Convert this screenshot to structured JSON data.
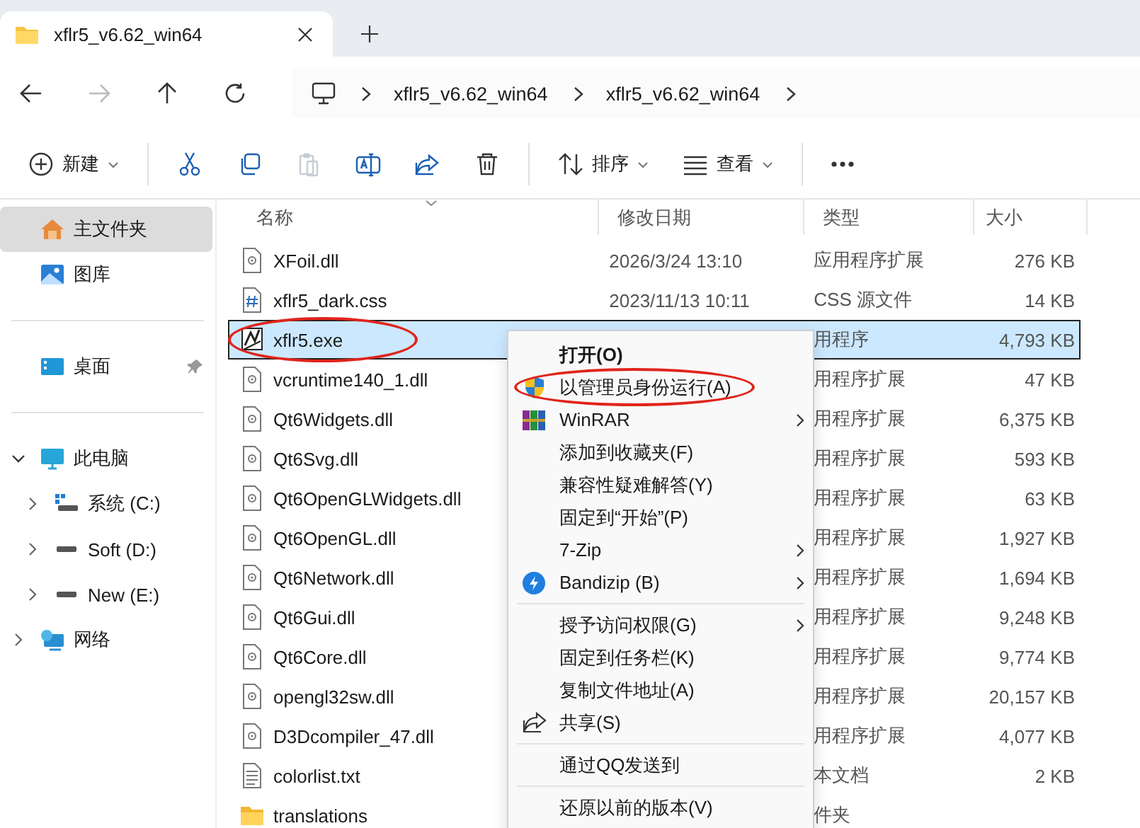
{
  "window": {
    "tab": {
      "title": "xflr5_v6.62_win64",
      "selected": true
    }
  },
  "address_bar": {
    "crumbs": [
      "xflr5_v6.62_win64",
      "xflr5_v6.62_win64"
    ]
  },
  "nav": [
    {
      "kind": "back",
      "disabled": false
    },
    {
      "kind": "forward",
      "disabled": true
    },
    {
      "kind": "up",
      "disabled": false
    },
    {
      "kind": "refresh",
      "disabled": false
    }
  ],
  "toolbar": [
    {
      "kind": "new",
      "label": "新建",
      "dropdown": true,
      "disabled": false
    },
    {
      "kind": "sep"
    },
    {
      "kind": "cut",
      "disabled": false
    },
    {
      "kind": "copy",
      "disabled": false
    },
    {
      "kind": "paste",
      "disabled": true
    },
    {
      "kind": "rename",
      "disabled": false
    },
    {
      "kind": "share",
      "disabled": false
    },
    {
      "kind": "delete",
      "disabled": false
    },
    {
      "kind": "sep"
    },
    {
      "kind": "sort",
      "label": "排序",
      "dropdown": true,
      "disabled": false
    },
    {
      "kind": "view",
      "label": "查看",
      "dropdown": true,
      "disabled": false
    },
    {
      "kind": "sep"
    },
    {
      "kind": "more",
      "disabled": false
    }
  ],
  "sidebar": {
    "sections": [
      [
        {
          "kind": "home",
          "label": "主文件夹",
          "selected": true,
          "pinned": false
        },
        {
          "kind": "gallery",
          "label": "图库",
          "selected": false,
          "pinned": false
        }
      ],
      [
        {
          "kind": "desktop",
          "label": "桌面",
          "selected": false,
          "pinned": true
        }
      ],
      [
        {
          "kind": "pc",
          "label": "此电脑",
          "selected": false,
          "pinned": false,
          "expanded": true,
          "children": [
            {
              "kind": "sysdrive",
              "label": "系统 (C:)",
              "selected": false,
              "pinned": false,
              "expanded": false
            },
            {
              "kind": "drive",
              "label": "Soft (D:)",
              "selected": false,
              "pinned": false,
              "expanded": false
            },
            {
              "kind": "drive",
              "label": "New (E:)",
              "selected": false,
              "pinned": false,
              "expanded": false
            }
          ]
        },
        {
          "kind": "network",
          "label": "网络",
          "selected": false,
          "pinned": false,
          "expanded": false
        }
      ]
    ]
  },
  "table": {
    "columns": [
      "名称",
      "修改日期",
      "类型",
      "大小"
    ],
    "rows": [
      {
        "kind": "dll",
        "name": "XFoil.dll",
        "date": "2026/3/24 13:10",
        "type": "应用程序扩展",
        "size": "276 KB",
        "selected": false,
        "circled": false
      },
      {
        "kind": "css",
        "name": "xflr5_dark.css",
        "date": "2023/11/13 10:11",
        "type": "CSS 源文件",
        "size": "14 KB",
        "selected": false,
        "circled": false
      },
      {
        "kind": "exe",
        "name": "xflr5.exe",
        "type": "用程序",
        "size": "4,793 KB",
        "selected": true,
        "circled": true
      },
      {
        "kind": "dll",
        "name": "vcruntime140_1.dll",
        "type": "用程序扩展",
        "size": "47 KB",
        "selected": false,
        "circled": false
      },
      {
        "kind": "dll",
        "name": "Qt6Widgets.dll",
        "type": "用程序扩展",
        "size": "6,375 KB",
        "selected": false,
        "circled": false
      },
      {
        "kind": "dll",
        "name": "Qt6Svg.dll",
        "type": "用程序扩展",
        "size": "593 KB",
        "selected": false,
        "circled": false
      },
      {
        "kind": "dll",
        "name": "Qt6OpenGLWidgets.dll",
        "type": "用程序扩展",
        "size": "63 KB",
        "selected": false,
        "circled": false
      },
      {
        "kind": "dll",
        "name": "Qt6OpenGL.dll",
        "type": "用程序扩展",
        "size": "1,927 KB",
        "selected": false,
        "circled": false
      },
      {
        "kind": "dll",
        "name": "Qt6Network.dll",
        "type": "用程序扩展",
        "size": "1,694 KB",
        "selected": false,
        "circled": false
      },
      {
        "kind": "dll",
        "name": "Qt6Gui.dll",
        "type": "用程序扩展",
        "size": "9,248 KB",
        "selected": false,
        "circled": false
      },
      {
        "kind": "dll",
        "name": "Qt6Core.dll",
        "type": "用程序扩展",
        "size": "9,774 KB",
        "selected": false,
        "circled": false
      },
      {
        "kind": "dll",
        "name": "opengl32sw.dll",
        "type": "用程序扩展",
        "size": "20,157 KB",
        "selected": false,
        "circled": false
      },
      {
        "kind": "dll",
        "name": "D3Dcompiler_47.dll",
        "type": "用程序扩展",
        "size": "4,077 KB",
        "selected": false,
        "circled": false
      },
      {
        "kind": "txt",
        "name": "colorlist.txt",
        "type": "本文档",
        "size": "2 KB",
        "selected": false,
        "circled": false
      },
      {
        "kind": "folder",
        "name": "translations",
        "type": "件夹",
        "selected": false,
        "circled": false
      }
    ]
  },
  "context_menu": {
    "groups": [
      [
        {
          "label": "打开(O)",
          "kind": "plain",
          "default": true,
          "submenu": false,
          "circled": false
        },
        {
          "label": "以管理员身份运行(A)",
          "kind": "shield",
          "default": false,
          "submenu": false,
          "circled": true
        },
        {
          "label": "WinRAR",
          "kind": "winrar",
          "default": false,
          "submenu": true,
          "circled": false
        },
        {
          "label": "添加到收藏夹(F)",
          "kind": "plain",
          "default": false,
          "submenu": false,
          "circled": false
        },
        {
          "label": "兼容性疑难解答(Y)",
          "kind": "plain",
          "default": false,
          "submenu": false,
          "circled": false
        },
        {
          "label": "固定到“开始”(P)",
          "kind": "plain",
          "default": false,
          "submenu": false,
          "circled": false
        },
        {
          "label": "7-Zip",
          "kind": "plain",
          "default": false,
          "submenu": true,
          "circled": false
        },
        {
          "label": "Bandizip (B)",
          "kind": "bandizip",
          "default": false,
          "submenu": true,
          "circled": false
        }
      ],
      [
        {
          "label": "授予访问权限(G)",
          "kind": "plain",
          "default": false,
          "submenu": true,
          "circled": false
        },
        {
          "label": "固定到任务栏(K)",
          "kind": "plain",
          "default": false,
          "submenu": false,
          "circled": false
        },
        {
          "label": "复制文件地址(A)",
          "kind": "plain",
          "default": false,
          "submenu": false,
          "circled": false
        },
        {
          "label": "共享(S)",
          "kind": "share",
          "default": false,
          "submenu": false,
          "circled": false
        }
      ],
      [
        {
          "label": "通过QQ发送到",
          "kind": "plain",
          "default": false,
          "submenu": false,
          "circled": false
        }
      ],
      [
        {
          "label": "还原以前的版本(V)",
          "kind": "plain",
          "default": false,
          "submenu": false,
          "circled": false
        }
      ]
    ]
  }
}
